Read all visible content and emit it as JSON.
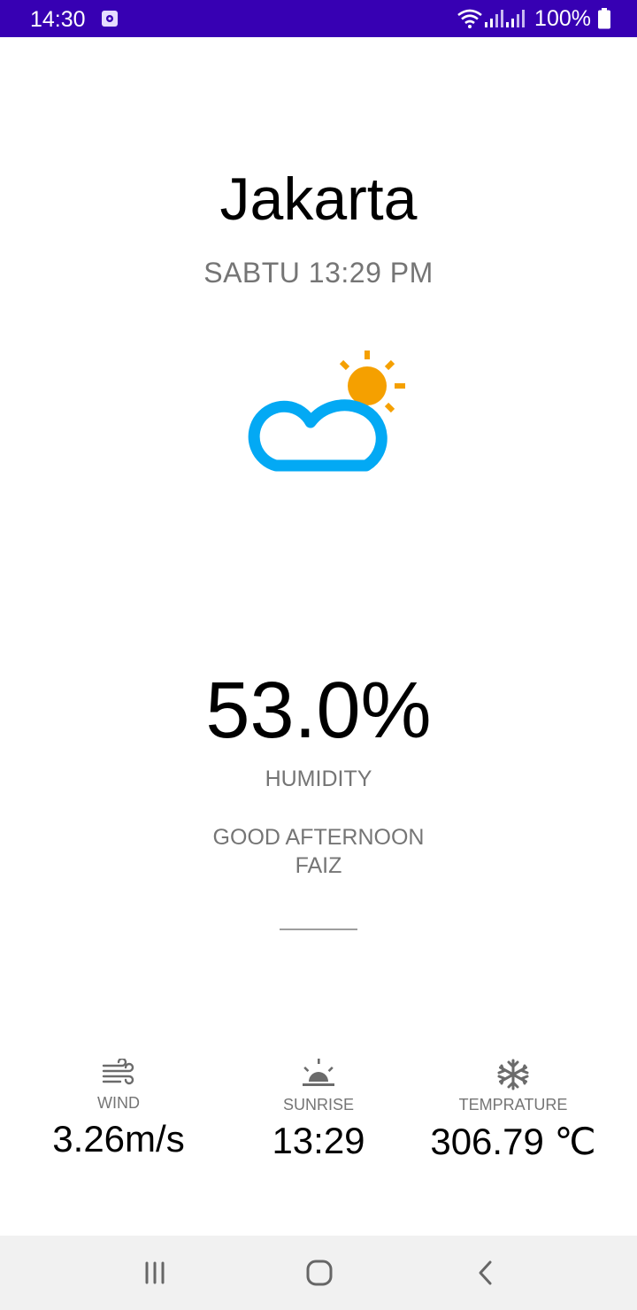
{
  "status_bar": {
    "time": "14:30",
    "battery": "100%",
    "background": "#3700b3"
  },
  "weather": {
    "city": "Jakarta",
    "datetime": "SABTU 13:29 PM",
    "icon": "partly-cloudy-icon",
    "humidity_value": "53.0%",
    "humidity_label": "HUMIDITY",
    "greeting_line1": "GOOD AFTERNOON",
    "greeting_line2": "FAIZ"
  },
  "stats": {
    "wind": {
      "icon": "wind-icon",
      "label": "WIND",
      "value": "3.26m/s"
    },
    "sunrise": {
      "icon": "sunrise-icon",
      "label": "SUNRISE",
      "value": "13:29"
    },
    "temperature": {
      "icon": "snowflake-icon",
      "label": "TEMPRATURE",
      "value": "306.79 ℃"
    }
  },
  "colors": {
    "cloud": "#03a9f4",
    "sun": "#f5a000",
    "secondary_text": "#757575"
  },
  "nav_bar": {
    "recent": "recent-apps-icon",
    "home": "home-icon",
    "back": "back-icon"
  }
}
